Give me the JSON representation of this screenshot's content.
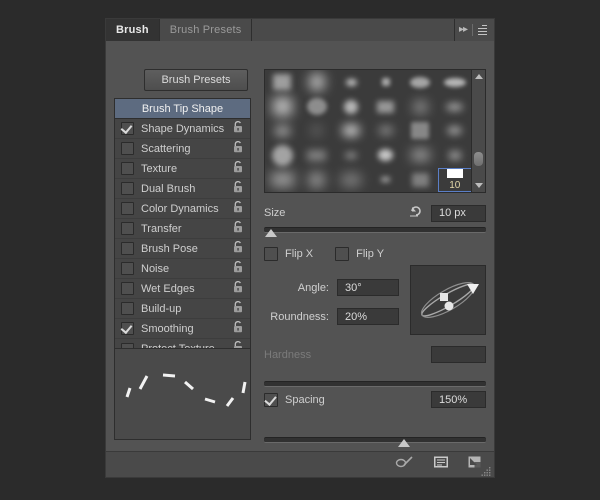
{
  "panel": {
    "tabs": [
      {
        "label": "Brush",
        "active": true
      },
      {
        "label": "Brush Presets",
        "active": false
      }
    ],
    "collapse_icon": "double-chevron-right-icon",
    "menu_icon": "panel-menu-icon",
    "presets_button": "Brush Presets"
  },
  "options_list": {
    "header": "Brush Tip Shape",
    "items": [
      {
        "label": "Shape Dynamics",
        "checked": true
      },
      {
        "label": "Scattering",
        "checked": false
      },
      {
        "label": "Texture",
        "checked": false
      },
      {
        "label": "Dual Brush",
        "checked": false
      },
      {
        "label": "Color Dynamics",
        "checked": false
      },
      {
        "label": "Transfer",
        "checked": false
      },
      {
        "label": "Brush Pose",
        "checked": false
      },
      {
        "label": "Noise",
        "checked": false
      },
      {
        "label": "Wet Edges",
        "checked": false
      },
      {
        "label": "Build-up",
        "checked": false
      },
      {
        "label": "Smoothing",
        "checked": true
      },
      {
        "label": "Protect Texture",
        "checked": false
      }
    ],
    "lock_icon": "unlocked-padlock-icon"
  },
  "brush_grid": {
    "selected_brush_label": "10",
    "selected_index": 29,
    "columns": 6,
    "rows": 5,
    "scroll_up_icon": "scroll-up-arrow-icon",
    "scroll_down_icon": "scroll-down-arrow-icon",
    "selection_color": "#5b7fc7"
  },
  "size": {
    "label": "Size",
    "value": "10 px",
    "reset_icon": "flip-reset-icon",
    "slider_percent": 3
  },
  "flip": {
    "x_label": "Flip X",
    "x_checked": false,
    "y_label": "Flip Y",
    "y_checked": false
  },
  "angle": {
    "label": "Angle:",
    "value": "30°"
  },
  "roundness": {
    "label": "Roundness:",
    "value": "20%"
  },
  "ellipse_preview": {
    "name": "angle-roundness-preview",
    "angle_degrees": -30,
    "roundness_percent": 20
  },
  "hardness": {
    "label": "Hardness",
    "value": "",
    "disabled": true,
    "slider_percent": 0
  },
  "spacing": {
    "label": "Spacing",
    "checked": true,
    "value": "150%",
    "slider_percent": 63
  },
  "stroke_preview": {
    "name": "brush-stroke-preview"
  },
  "footer": {
    "icons": [
      {
        "name": "toggle-brush-preview-icon"
      },
      {
        "name": "open-preset-manager-icon"
      },
      {
        "name": "create-new-brush-icon"
      }
    ],
    "grip_icon": "resize-grip-icon"
  },
  "colors": {
    "panel_bg": "#535353",
    "tabbar_bg": "#4a4a4a",
    "active_tab_bg": "#333333",
    "list_bg": "#454545",
    "list_header_bg": "#5d6b80",
    "field_bg": "#3a3a3a",
    "text": "#cfcfcf",
    "accent": "#5b7fc7"
  }
}
